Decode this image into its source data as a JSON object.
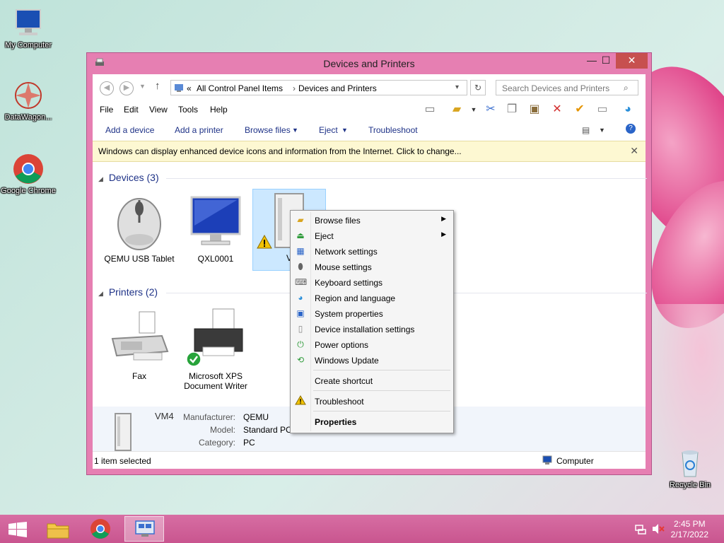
{
  "desktop": {
    "icons": [
      {
        "label": "My Computer"
      },
      {
        "label": "DataWagon..."
      },
      {
        "label": "Google Chrome"
      },
      {
        "label": "Recycle Bin"
      }
    ]
  },
  "window": {
    "title": "Devices and Printers",
    "controls": {
      "minimize": "—",
      "maximize": "☐",
      "close": "✕"
    },
    "address": {
      "prefix": "«",
      "crumbs": [
        "All Control Panel Items",
        "Devices and Printers"
      ]
    },
    "search": {
      "placeholder": "Search Devices and Printers"
    },
    "menu": [
      "File",
      "Edit",
      "View",
      "Tools",
      "Help"
    ],
    "commands": {
      "add_device": "Add a device",
      "add_printer": "Add a printer",
      "browse_files": "Browse files",
      "eject": "Eject",
      "troubleshoot": "Troubleshoot"
    },
    "infobar": "Windows can display enhanced device icons and information from the Internet. Click to change...",
    "groups": {
      "devices": {
        "title": "Devices (3)"
      },
      "printers": {
        "title": "Printers (2)"
      }
    },
    "devices": [
      {
        "label": "QEMU USB Tablet"
      },
      {
        "label": "QXL0001"
      },
      {
        "label": "V"
      }
    ],
    "printers": [
      {
        "label": "Fax"
      },
      {
        "label": "Microsoft XPS Document Writer"
      }
    ],
    "details": {
      "name": "VM4",
      "manufacturer_label": "Manufacturer:",
      "manufacturer": "QEMU",
      "model_label": "Model:",
      "model": "Standard PC",
      "category_label": "Category:",
      "category": "PC"
    },
    "status": {
      "left": "1 item selected",
      "right": "Computer"
    }
  },
  "context_menu": {
    "items": [
      {
        "label": "Browse files",
        "icon": "folder-icon",
        "submenu": true
      },
      {
        "label": "Eject",
        "icon": "eject-icon",
        "submenu": true
      },
      {
        "label": "Network settings",
        "icon": "network-icon"
      },
      {
        "label": "Mouse settings",
        "icon": "mouse-icon"
      },
      {
        "label": "Keyboard settings",
        "icon": "keyboard-icon"
      },
      {
        "label": "Region and language",
        "icon": "globe-icon"
      },
      {
        "label": "System properties",
        "icon": "system-icon"
      },
      {
        "label": "Device installation settings",
        "icon": "device-icon"
      },
      {
        "label": "Power options",
        "icon": "power-icon"
      },
      {
        "label": "Windows Update",
        "icon": "update-icon"
      },
      {
        "label": "Create shortcut"
      },
      {
        "label": "Troubleshoot",
        "icon": "warning-icon"
      },
      {
        "label": "Properties",
        "bold": true
      }
    ]
  },
  "taskbar": {
    "time": "2:45 PM",
    "date": "2/17/2022"
  },
  "colors": {
    "window_frame": "#e67fb2",
    "close_button": "#c7504f",
    "taskbar": "#d35c98",
    "link_blue": "#1e3287"
  }
}
